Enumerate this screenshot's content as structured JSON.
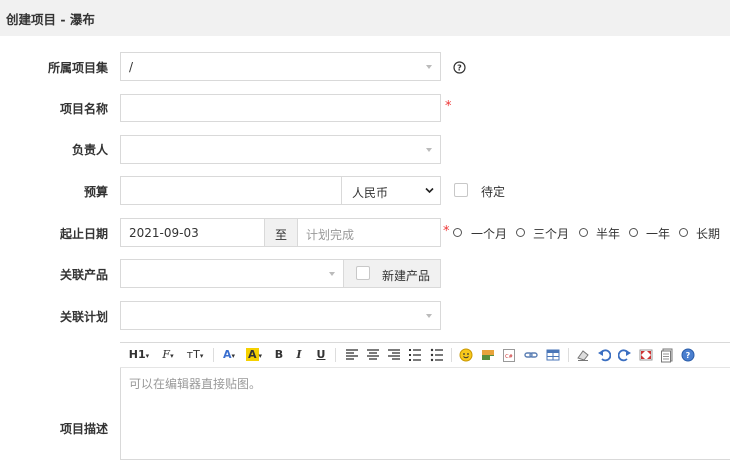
{
  "header": {
    "title": "创建项目 - 瀑布"
  },
  "form": {
    "project_set": {
      "label": "所属项目集",
      "value": "/"
    },
    "project_name": {
      "label": "项目名称",
      "value": "",
      "required_mark": "*"
    },
    "owner": {
      "label": "负责人",
      "value": ""
    },
    "budget": {
      "label": "预算",
      "value": "",
      "currency": "人民币",
      "tbd_label": "待定"
    },
    "dates": {
      "label": "起止日期",
      "start": "2021-09-03",
      "to_label": "至",
      "end_placeholder": "计划完成",
      "required_mark": "*",
      "options": [
        "一个月",
        "三个月",
        "半年",
        "一年",
        "长期"
      ]
    },
    "product": {
      "label": "关联产品",
      "value": "",
      "new_product_label": "新建产品"
    },
    "plan": {
      "label": "关联计划",
      "value": ""
    },
    "description": {
      "label": "项目描述",
      "placeholder": "可以在编辑器直接贴图。"
    }
  },
  "toolbar": {
    "heading": "H1",
    "font_family": "F",
    "font_size": "тT",
    "bold": "B",
    "italic": "I",
    "underline": "U"
  },
  "colors": {
    "required": "#e33",
    "header_bg": "#f1f1f1",
    "border": "#d9d9d9"
  }
}
